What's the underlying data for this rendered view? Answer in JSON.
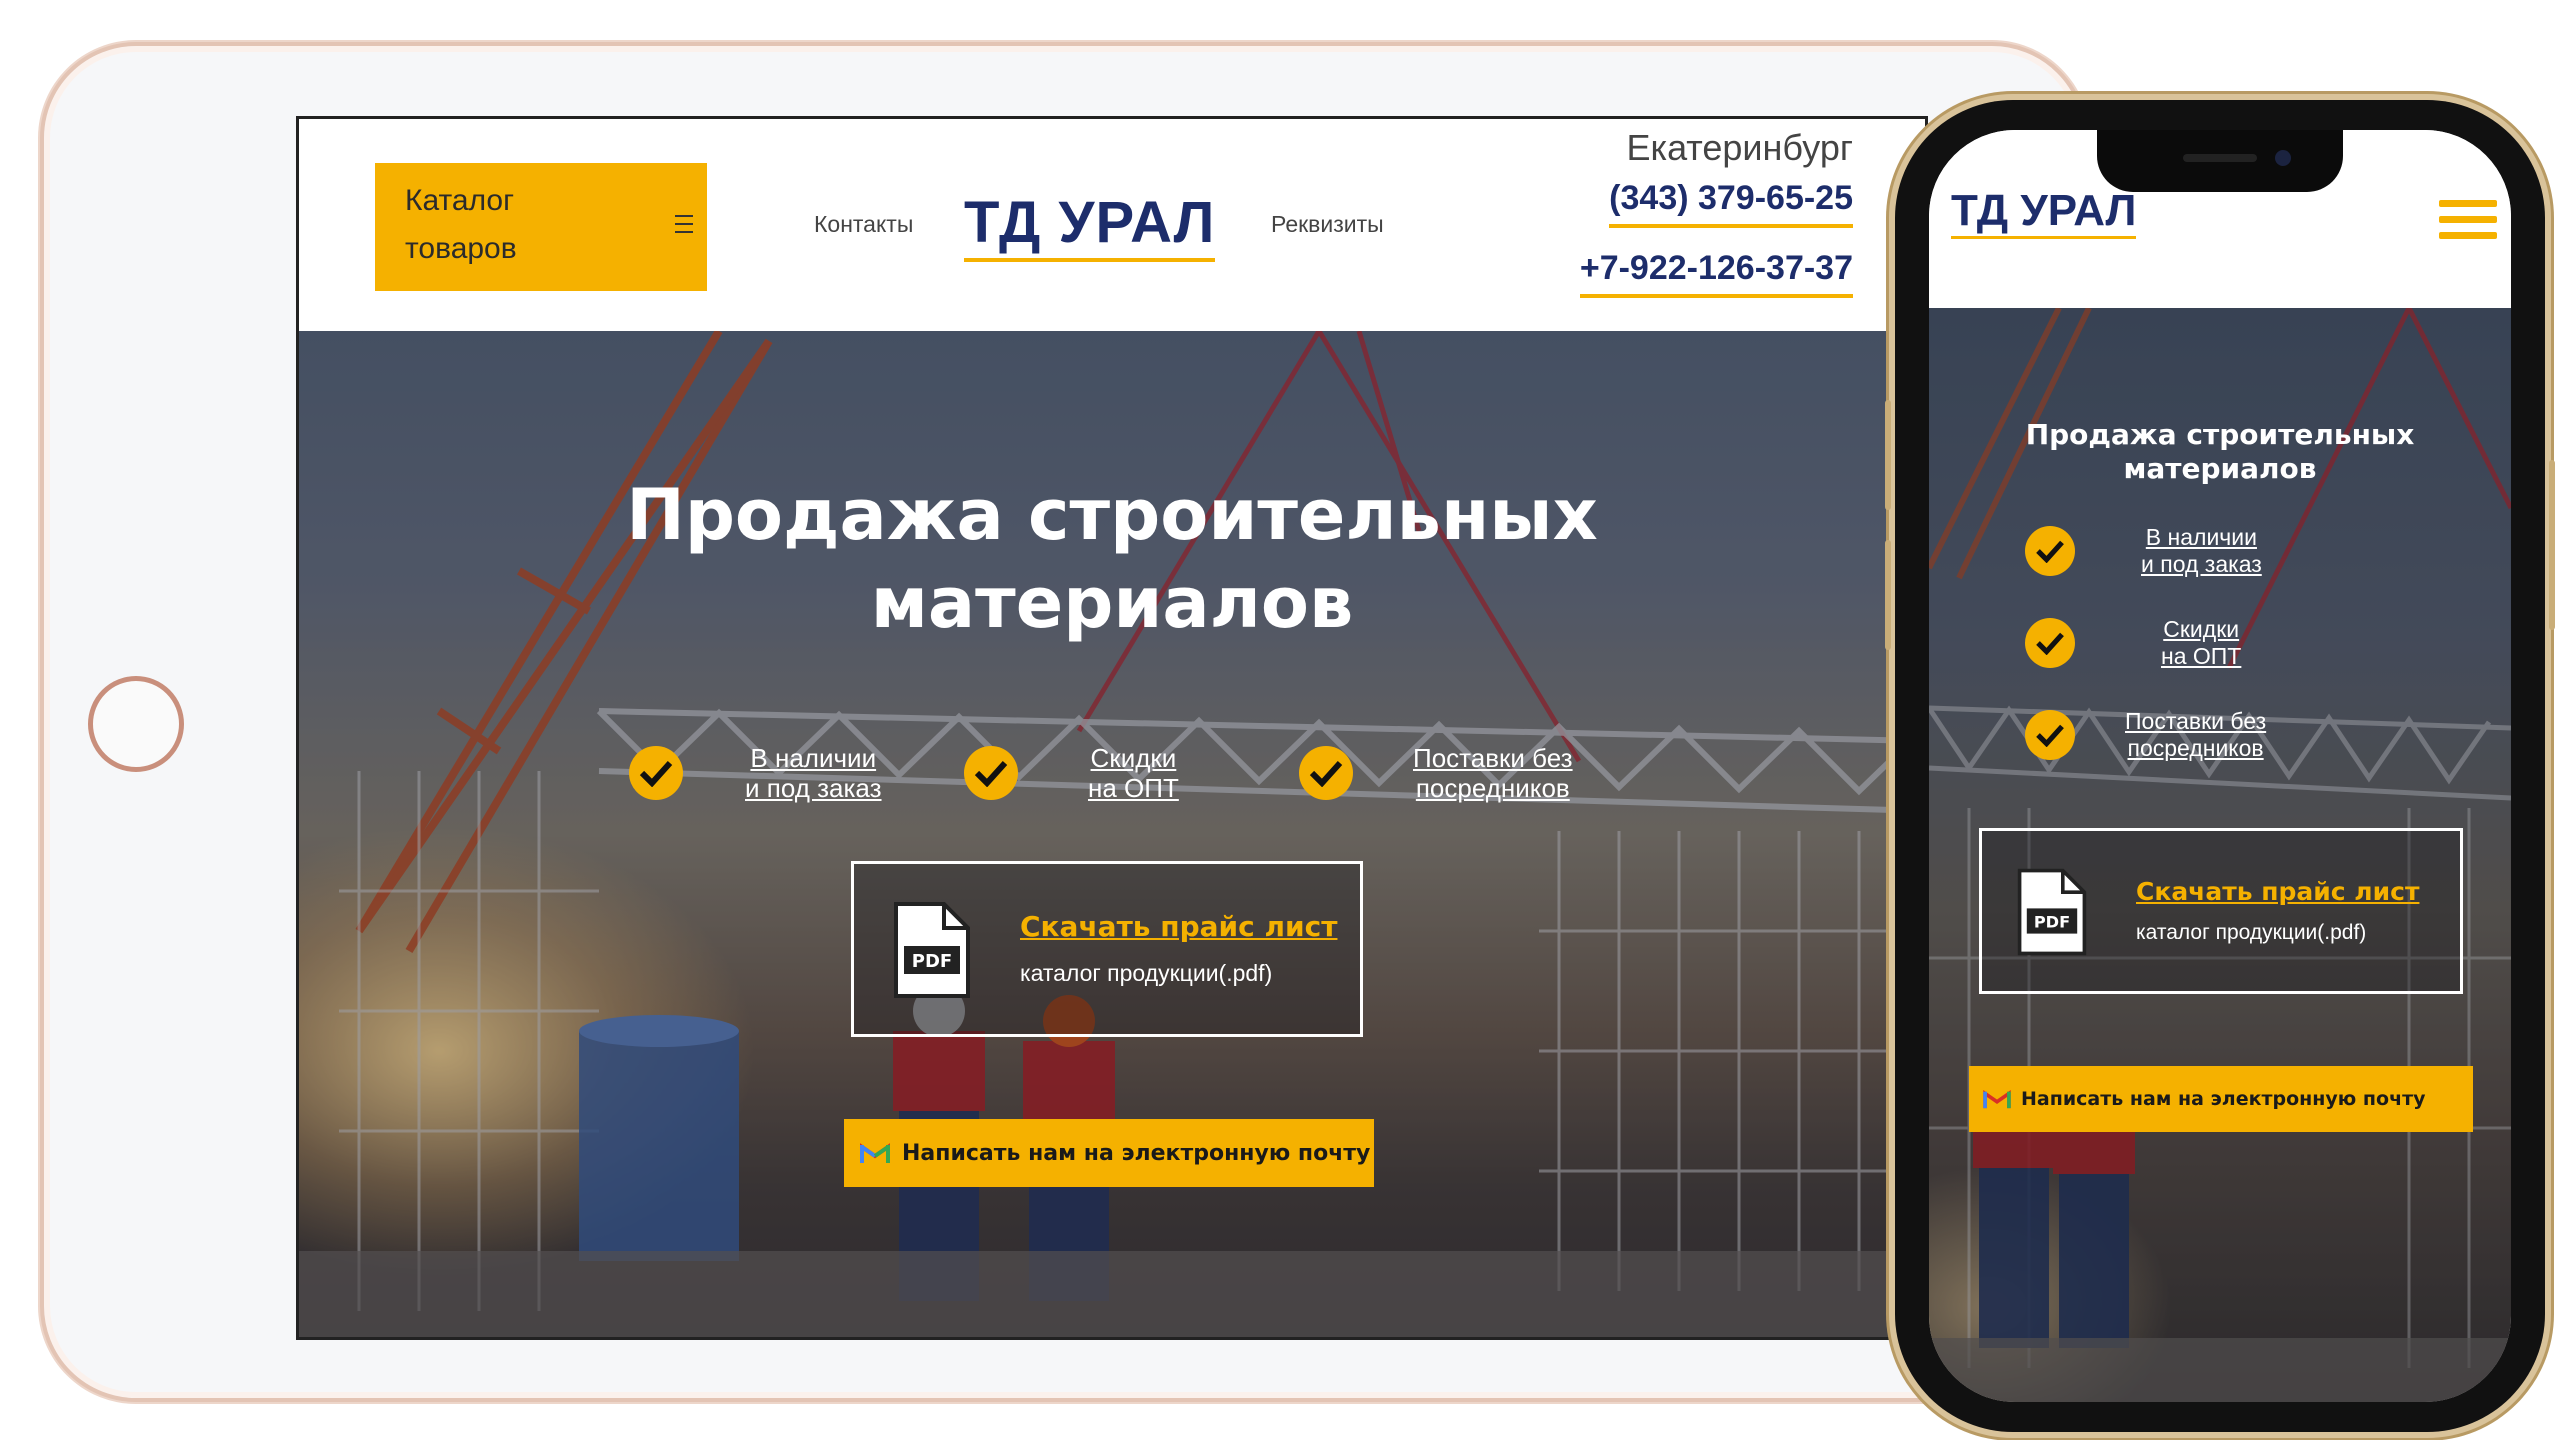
{
  "tablet": {
    "header": {
      "catalog_button": "Каталог товаров",
      "catalog_line1": "Каталог",
      "catalog_line2": "товаров",
      "nav_contacts": "Контакты",
      "logo": "ТД УРАЛ",
      "nav_requisites": "Реквизиты",
      "city": "Екатеринбург",
      "phone1": "(343) 379-65-25",
      "phone2": "+7-922-126-37-37"
    },
    "hero": {
      "title_line1": "Продажа строительных",
      "title_line2": "материалов",
      "features": [
        {
          "line1": "В наличии",
          "line2": "и под заказ"
        },
        {
          "line1": "Скидки",
          "line2": "на ОПТ"
        },
        {
          "line1": "Поставки без",
          "line2": "посредников"
        }
      ],
      "price_box": {
        "icon_label": "PDF",
        "title": "Скачать прайс лист",
        "subtitle": "каталог продукции(.pdf)"
      },
      "mail_button": "Написать нам на электронную почту"
    }
  },
  "phone": {
    "header": {
      "logo": "ТД УРАЛ"
    },
    "hero": {
      "title_line1": "Продажа строительных",
      "title_line2": "материалов",
      "features": [
        {
          "line1": "В наличии",
          "line2": "и под заказ"
        },
        {
          "line1": "Скидки",
          "line2": "на ОПТ"
        },
        {
          "line1": "Поставки без",
          "line2": "посредников"
        }
      ],
      "price_box": {
        "icon_label": "PDF",
        "title": "Скачать прайс лист",
        "subtitle": "каталог продукции(.pdf)"
      },
      "mail_button": "Написать нам на электронную почту"
    }
  },
  "colors": {
    "accent": "#f5b100",
    "brand_navy": "#1d2d6b",
    "tablet_frame": "#e3c4b4",
    "phone_frame": "#d9c39a"
  },
  "icons": [
    "burger-menu-icon",
    "check-icon",
    "pdf-file-icon",
    "gmail-icon",
    "home-button-icon"
  ]
}
